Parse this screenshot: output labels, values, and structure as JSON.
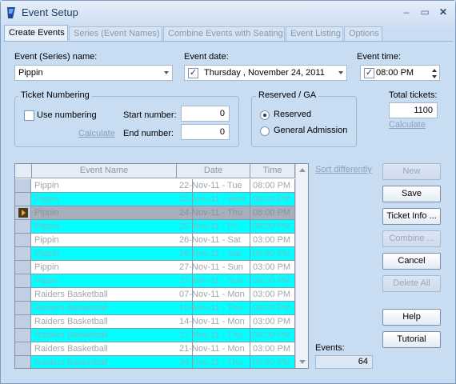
{
  "window": {
    "title": "Event Setup"
  },
  "tabs": [
    {
      "label": "Create Events",
      "active": true
    },
    {
      "label": "Series (Event Names)",
      "active": false
    },
    {
      "label": "Combine Events with Seating",
      "active": false
    },
    {
      "label": "Event Listing",
      "active": false
    },
    {
      "label": "Options",
      "active": false
    }
  ],
  "form": {
    "event_series_label": "Event (Series) name:",
    "event_series_value": "Pippin",
    "event_date_label": "Event date:",
    "event_date_value": "Thursday  , November  24, 2011",
    "event_date_checked": true,
    "event_time_label": "Event time:",
    "event_time_value": "08:00  PM",
    "event_time_checked": true,
    "total_tickets_label": "Total tickets:",
    "total_tickets_value": "1100",
    "total_calculate_link": "Calculate"
  },
  "ticket_numbering": {
    "title": "Ticket Numbering",
    "use_numbering_label": "Use numbering",
    "use_numbering_checked": false,
    "start_label": "Start number:",
    "start_value": "0",
    "end_label": "End number:",
    "end_value": "0",
    "calculate_link": "Calculate"
  },
  "reserved_ga": {
    "title": "Reserved / GA",
    "options": [
      {
        "label": "Reserved",
        "selected": true
      },
      {
        "label": "General Admission",
        "selected": false
      }
    ]
  },
  "grid": {
    "columns": [
      "Event Name",
      "Date",
      "Time"
    ],
    "rows": [
      {
        "name": "Pippin",
        "date": "22-Nov-11 - Tue",
        "time": "08:00 PM"
      },
      {
        "name": "Pippin",
        "date": "23-Nov-11 - Wed",
        "time": "08:00 PM"
      },
      {
        "name": "Pippin",
        "date": "24-Nov-11 - Thu",
        "time": "08:00 PM"
      },
      {
        "name": "Pippin",
        "date": "25-Nov-11 - Fri",
        "time": "08:00 PM"
      },
      {
        "name": "Pippin",
        "date": "26-Nov-11 - Sat",
        "time": "03:00 PM"
      },
      {
        "name": "Pippin",
        "date": "26-Nov-11 - Sat",
        "time": "08:00 PM"
      },
      {
        "name": "Pippin",
        "date": "27-Nov-11 - Sun",
        "time": "03:00 PM"
      },
      {
        "name": "Pippin",
        "date": "27-Nov-11 - Sun",
        "time": "08:00 PM"
      },
      {
        "name": "Raiders Basketball",
        "date": "07-Nov-11 - Mon",
        "time": "03:00 PM"
      },
      {
        "name": "Raiders Basketball",
        "date": "10-Nov-11 - Thu",
        "time": "08:00 PM"
      },
      {
        "name": "Raiders Basketball",
        "date": "14-Nov-11 - Mon",
        "time": "03:00 PM"
      },
      {
        "name": "Raiders Basketball",
        "date": "17-Nov-11 - Thu",
        "time": "08:00 PM"
      },
      {
        "name": "Raiders Basketball",
        "date": "21-Nov-11 - Mon",
        "time": "03:00 PM"
      },
      {
        "name": "Raiders Basketball",
        "date": "24-Nov-11 - Thu",
        "time": "08:00 PM"
      }
    ],
    "sort_differently_link": "Sort differently",
    "events_label": "Events:",
    "events_count": "64"
  },
  "buttons": {
    "new": "New",
    "save": "Save",
    "ticket_info": "Ticket Info ...",
    "combine": "Combine ...",
    "cancel": "Cancel",
    "delete_all": "Delete All",
    "help": "Help",
    "tutorial": "Tutorial"
  },
  "icons": {
    "app": "app-logo-icon",
    "minimize": "minimize-icon",
    "maximize": "maximize-icon",
    "close": "close-icon"
  }
}
